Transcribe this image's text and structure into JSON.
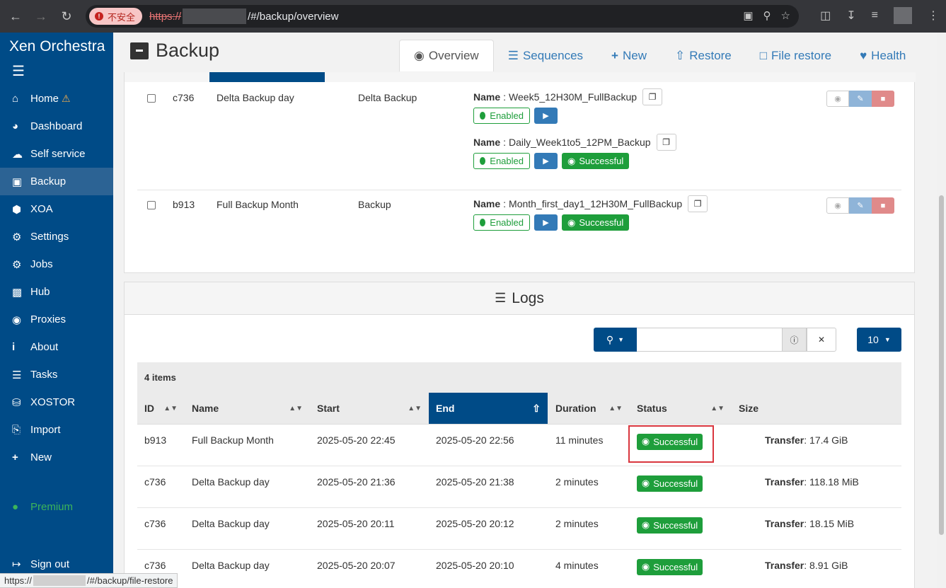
{
  "browser": {
    "insecure_label": "不安全",
    "url_protocol": "https://",
    "url_path": "/#/backup/overview"
  },
  "sidebar": {
    "brand": "Xen Orchestra",
    "items": [
      {
        "label": "Home",
        "icon": "home-icon"
      },
      {
        "label": "Dashboard",
        "icon": "dashboard-icon"
      },
      {
        "label": "Self service",
        "icon": "cloud-icon"
      },
      {
        "label": "Backup",
        "icon": "archive-icon"
      },
      {
        "label": "XOA",
        "icon": "cube-icon"
      },
      {
        "label": "Settings",
        "icon": "gear-icon"
      },
      {
        "label": "Jobs",
        "icon": "gears-icon"
      },
      {
        "label": "Hub",
        "icon": "cubes-icon"
      },
      {
        "label": "Proxies",
        "icon": "globe-icon"
      },
      {
        "label": "About",
        "icon": "info-icon"
      },
      {
        "label": "Tasks",
        "icon": "tasks-icon"
      },
      {
        "label": "XOSTOR",
        "icon": "database-icon"
      },
      {
        "label": "Import",
        "icon": "import-icon"
      },
      {
        "label": "New",
        "icon": "plus-icon"
      }
    ],
    "premium": "Premium",
    "signout": "Sign out"
  },
  "header": {
    "title": "Backup",
    "tabs": [
      {
        "label": "Overview",
        "icon": "eye-icon"
      },
      {
        "label": "Sequences",
        "icon": "list-icon"
      },
      {
        "label": "New",
        "icon": "plus-icon"
      },
      {
        "label": "Restore",
        "icon": "upload-icon"
      },
      {
        "label": "File restore",
        "icon": "file-icon"
      },
      {
        "label": "Health",
        "icon": "heartbeat-icon"
      }
    ]
  },
  "jobs": [
    {
      "id": "c736",
      "name": "Delta Backup day",
      "mode": "Delta Backup",
      "schedules": [
        {
          "name_label": "Name",
          "name": "Week5_12H30M_FullBackup",
          "enabled": "Enabled",
          "status": ""
        },
        {
          "name_label": "Name",
          "name": "Daily_Week1to5_12PM_Backup",
          "enabled": "Enabled",
          "status": "Successful"
        }
      ]
    },
    {
      "id": "b913",
      "name": "Full Backup Month",
      "mode": "Backup",
      "schedules": [
        {
          "name_label": "Name",
          "name": "Month_first_day1_12H30M_FullBackup",
          "enabled": "Enabled",
          "status": "Successful"
        }
      ]
    }
  ],
  "logs": {
    "title": "Logs",
    "filter_value": "",
    "page_size": "10",
    "items_count": "4 items",
    "columns": [
      "ID",
      "Name",
      "Start",
      "End",
      "Duration",
      "Status",
      "Size"
    ],
    "transfer_label": "Transfer",
    "rows": [
      {
        "id": "b913",
        "name": "Full Backup Month",
        "start": "2025-05-20 22:45",
        "end": "2025-05-20 22:56",
        "duration": "11 minutes",
        "status": "Successful",
        "size": "17.4 GiB"
      },
      {
        "id": "c736",
        "name": "Delta Backup day",
        "start": "2025-05-20 21:36",
        "end": "2025-05-20 21:38",
        "duration": "2 minutes",
        "status": "Successful",
        "size": "118.18 MiB"
      },
      {
        "id": "c736",
        "name": "Delta Backup day",
        "start": "2025-05-20 20:11",
        "end": "2025-05-20 20:12",
        "duration": "2 minutes",
        "status": "Successful",
        "size": "18.15 MiB"
      },
      {
        "id": "c736",
        "name": "Delta Backup day",
        "start": "2025-05-20 20:07",
        "end": "2025-05-20 20:10",
        "duration": "4 minutes",
        "status": "Successful",
        "size": "8.91 GiB"
      }
    ]
  },
  "status_bar": {
    "protocol": "https://",
    "path": "/#/backup/file-restore"
  }
}
